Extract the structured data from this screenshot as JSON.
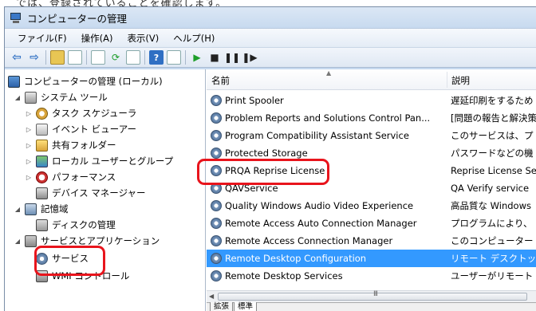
{
  "caption_fragment": "では、登録されていることを確認します。",
  "window": {
    "title": "コンピューターの管理"
  },
  "menu": [
    "ファイル(F)",
    "操作(A)",
    "表示(V)",
    "ヘルプ(H)"
  ],
  "toolbar_icons": [
    "back-icon",
    "forward-icon",
    "folder-up-icon",
    "show-tree-icon",
    "properties-icon",
    "refresh-icon",
    "export-icon",
    "help-icon",
    "view-icon",
    "play-icon",
    "stop-icon",
    "pause-icon",
    "restart-icon"
  ],
  "tree": {
    "root": "コンピューターの管理 (ローカル)",
    "system_tools": "システム ツール",
    "task_scheduler": "タスク スケジューラ",
    "event_viewer": "イベント ビューアー",
    "shared_folders": "共有フォルダー",
    "local_users": "ローカル ユーザーとグループ",
    "performance": "パフォーマンス",
    "device_manager": "デバイス マネージャー",
    "storage": "記憶域",
    "disk_management": "ディスクの管理",
    "services_apps": "サービスとアプリケーション",
    "services": "サービス",
    "wmi_control": "WMI コントロール"
  },
  "columns": {
    "name": "名前",
    "description": "説明"
  },
  "services": [
    {
      "name": "Print Spooler",
      "description": "遅延印刷をするため"
    },
    {
      "name": "Problem Reports and Solutions Control Pan...",
      "description": "[問題の報告と解決策"
    },
    {
      "name": "Program Compatibility Assistant Service",
      "description": "このサービスは、プ"
    },
    {
      "name": "Protected Storage",
      "description": "パスワードなどの機"
    },
    {
      "name": "PRQA Reprise License",
      "description": "Reprise License Se"
    },
    {
      "name": "QAVService",
      "description": "QA Verify service"
    },
    {
      "name": "Quality Windows Audio Video Experience",
      "description": "高品質な Windows "
    },
    {
      "name": "Remote Access Auto Connection Manager",
      "description": "プログラムにより、"
    },
    {
      "name": "Remote Access Connection Manager",
      "description": "このコンピューター"
    },
    {
      "name": "Remote Desktop Configuration",
      "description": "リモート デスクトッ",
      "selected": true
    },
    {
      "name": "Remote Desktop Services",
      "description": "ユーザーがリモート"
    }
  ],
  "tabs": [
    "拡張",
    "標準"
  ],
  "scroll_grip": "III",
  "colors": {
    "selection": "#3399ff",
    "highlight_box": "#e8141c"
  }
}
